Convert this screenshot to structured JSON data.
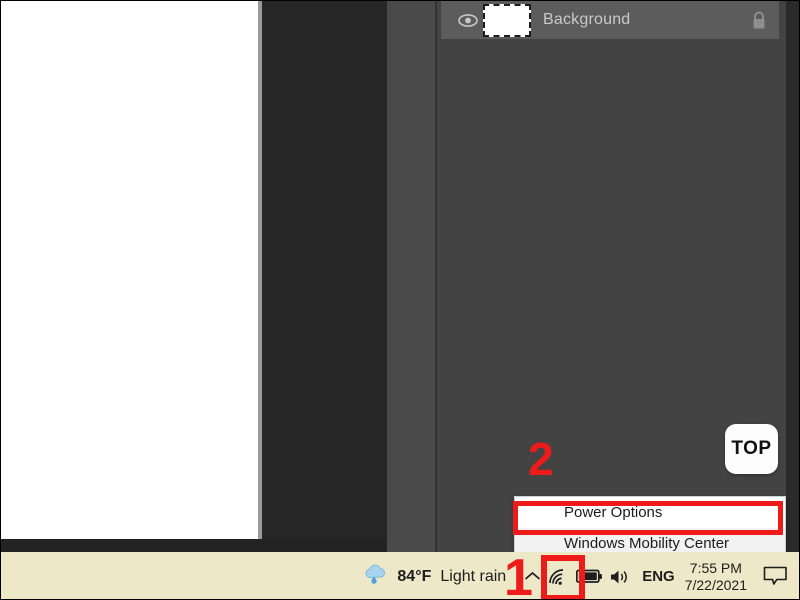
{
  "editor": {
    "layers_panel": {
      "layer": {
        "name": "Background",
        "visibility_icon": "eye-icon",
        "lock_icon": "lock-icon",
        "thumbnail": "layer-thumbnail"
      }
    }
  },
  "overlay": {
    "top_badge": "TOP",
    "annotations": [
      {
        "id": "1",
        "label": "1"
      },
      {
        "id": "2",
        "label": "2"
      }
    ],
    "highlight_color": "#ee1b1b"
  },
  "context_menu": {
    "items": [
      {
        "label": "Power Options",
        "highlighted": true
      },
      {
        "label": "Windows Mobility Center",
        "highlighted": false
      }
    ]
  },
  "taskbar": {
    "background_color": "#ece8c8",
    "weather": {
      "icon": "cloud-rain-icon",
      "temperature": "84°F",
      "condition": "Light rain"
    },
    "chevron_icon": "chevron-up-icon",
    "network_icon": "wifi-icon",
    "battery_icon": "battery-icon",
    "volume_icon": "speaker-icon",
    "language": "ENG",
    "clock": {
      "time": "7:55 PM",
      "date": "7/22/2021"
    },
    "notifications_icon": "chat-bubble-icon"
  }
}
